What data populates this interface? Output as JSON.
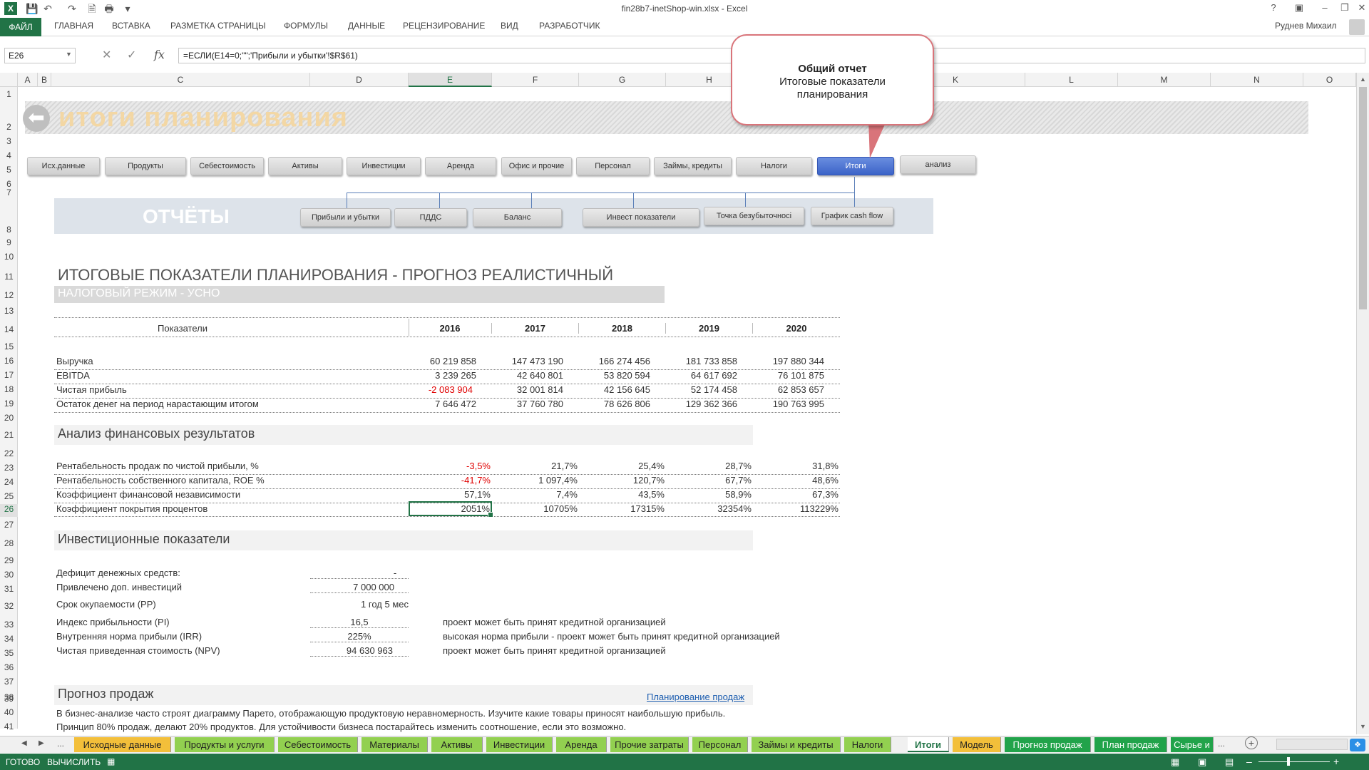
{
  "app": {
    "title": "fin28b7-inetShop-win.xlsx - Excel",
    "user": "Руднев Михаил"
  },
  "ribbon": {
    "file": "ФАЙЛ",
    "tabs": [
      "ГЛАВНАЯ",
      "ВСТАВКА",
      "РАЗМЕТКА СТРАНИЦЫ",
      "ФОРМУЛЫ",
      "ДАННЫЕ",
      "РЕЦЕНЗИРОВАНИЕ",
      "ВИД",
      "РАЗРАБОТЧИК"
    ]
  },
  "formula_bar": {
    "name_box": "E26",
    "formula": "=ЕСЛИ(E14=0;\"\";'Прибыли и убытки'!$R$61)"
  },
  "columns": [
    "A",
    "B",
    "C",
    "D",
    "E",
    "F",
    "G",
    "H",
    "I",
    "J",
    "K",
    "L",
    "M",
    "N",
    "O"
  ],
  "rows": [
    "1",
    "2",
    "3",
    "4",
    "5",
    "6",
    "7",
    "8",
    "9",
    "10",
    "11",
    "12",
    "13",
    "14",
    "15",
    "16",
    "17",
    "18",
    "19",
    "20",
    "21",
    "22",
    "23",
    "24",
    "25",
    "26",
    "27",
    "28",
    "29",
    "30",
    "31",
    "32",
    "33",
    "34",
    "35",
    "36",
    "37",
    "38",
    "39",
    "40",
    "41"
  ],
  "banner": {
    "title": "итоги планирования"
  },
  "nav": [
    "Исх.данные",
    "Продукты",
    "Себестоимость",
    "Активы",
    "Инвестиции",
    "Аренда",
    "Офис и прочие",
    "Персонал",
    "Займы, кредиты",
    "Налоги",
    "Итоги",
    "анализ"
  ],
  "reports": {
    "label": "ОТЧЁТЫ",
    "buttons": [
      "Прибыли и убытки",
      "ПДДС",
      "Баланс",
      "Инвест показатели",
      "Точка безубыточносi",
      "График cash flow"
    ]
  },
  "callout": {
    "title": "Общий отчет",
    "text": "Итоговые показатели планирования"
  },
  "main": {
    "title": "ИТОГОВЫЕ ПОКАЗАТЕЛИ ПЛАНИРОВАНИЯ  - ПРОГНОЗ РЕАЛИСТИЧНЫЙ",
    "tax_mode": "НАЛОГОВЫЙ РЕЖИМ - УСНО"
  },
  "table1": {
    "header": "Показатели",
    "years": [
      "2016",
      "2017",
      "2018",
      "2019",
      "2020"
    ],
    "rows": [
      {
        "label": "Выручка",
        "values": [
          "60 219 858",
          "147 473 190",
          "166 274 456",
          "181 733 858",
          "197 880 344"
        ]
      },
      {
        "label": "EBITDA",
        "values": [
          "3 239 265",
          "42 640 801",
          "53 820 594",
          "64 617 692",
          "76 101 875"
        ]
      },
      {
        "label": "Чистая прибыль",
        "values": [
          "-2 083 904",
          "32 001 814",
          "42 156 645",
          "52 174 458",
          "62 853 657"
        ]
      },
      {
        "label": "Остаток денег на период нарастающим итогом",
        "values": [
          "7 646 472",
          "37 760 780",
          "78 626 806",
          "129 362 366",
          "190 763 995"
        ]
      }
    ]
  },
  "analysis": {
    "title": "Анализ финансовых результатов",
    "rows": [
      {
        "label": "Рентабельность продаж по чистой прибыли, %",
        "values": [
          "-3,5%",
          "21,7%",
          "25,4%",
          "28,7%",
          "31,8%"
        ]
      },
      {
        "label": "Рентабельность собственного капитала,  ROE %",
        "values": [
          "-41,7%",
          "1 097,4%",
          "120,7%",
          "67,7%",
          "48,6%"
        ]
      },
      {
        "label": "Коэффициент финансовой независимости",
        "values": [
          "57,1%",
          "7,4%",
          "43,5%",
          "58,9%",
          "67,3%"
        ]
      },
      {
        "label": "Коэффициент покрытия процентов",
        "values": [
          "2051%",
          "10705%",
          "17315%",
          "32354%",
          "113229%"
        ]
      }
    ]
  },
  "invest": {
    "title": "Инвестиционные показатели",
    "rows": [
      {
        "label": "Дефицит денежных средств:",
        "value": "-",
        "note": ""
      },
      {
        "label": "Привлечено доп. инвестиций",
        "value": "7 000 000",
        "note": ""
      },
      {
        "label": "Срок окупаемости  (PP)",
        "value": "1 год 5 мес",
        "note": ""
      },
      {
        "label": "Индекс прибыльности  (PI)",
        "value": "16,5",
        "note": "проект может быть принят кредитной организацией"
      },
      {
        "label": "Внутренняя норма прибыли (IRR)",
        "value": "225%",
        "note": "высокая норма прибыли - проект может быть принят кредитной организацией"
      },
      {
        "label": "Чистая приведенная стоимость (NPV)",
        "value": "94 630 963",
        "note": "проект может быть принят кредитной организацией"
      }
    ]
  },
  "sales": {
    "title": "Прогноз продаж",
    "link": "Планирование продаж",
    "text1": "В бизнес-анализе часто строят диаграмму Парето, отображающую продуктовую неравномерность. Изучите какие товары приносят наибольшую прибыль.",
    "text2": "Принцип 80% продаж, делают 20% продуктов. Для устойчивости бизнеса постарайтесь изменить соотношение, если это возможно."
  },
  "sheet_tabs": [
    "Исходные данные",
    "Продукты и услуги",
    "Себестоимость",
    "Материалы",
    "Активы",
    "Инвестиции",
    "Аренда",
    "Прочие затраты",
    "Персонал",
    "Займы и кредиты",
    "Налоги",
    "Итоги",
    "Модель",
    "Прогноз продаж",
    "План продаж",
    "Сырье и"
  ],
  "status": {
    "ready": "ГОТОВО",
    "calc": "ВЫЧИСЛИТЬ"
  },
  "colors": {
    "excel_green": "#217346",
    "accent_blue": "#3b63c8",
    "negative": "#e00000"
  }
}
